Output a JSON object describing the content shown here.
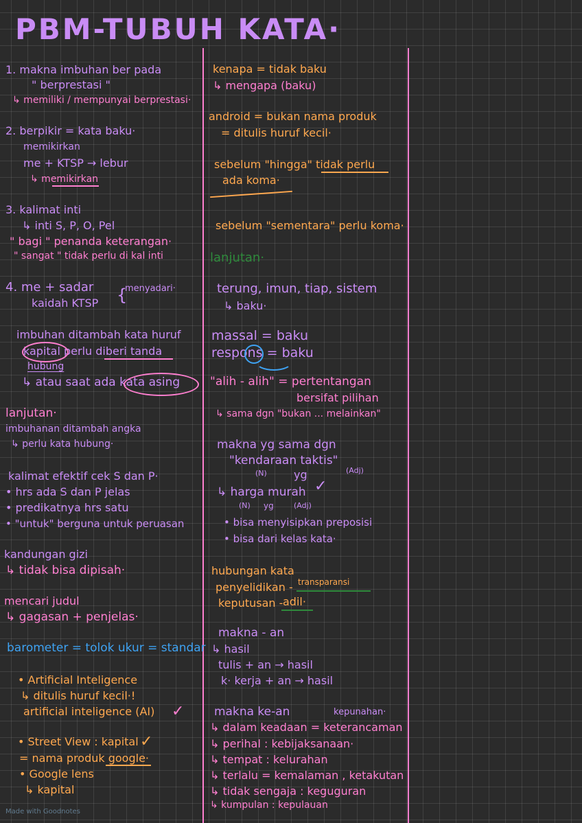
{
  "title": "PBM-TUBUH KATA·",
  "colors": {
    "background": "#2b2b2b",
    "purple": "#c98cf5",
    "pink": "#ff7fd0",
    "orange": "#ffa84f",
    "blue": "#3ea2f2",
    "green": "#2f8a3c",
    "divider": "#ff7fd0"
  },
  "left": [
    "1. makna imbuhan ber pada",
    "\" berprestasi \"",
    "↳ memiliki / mempunyai berprestasi·",
    "2. berpikir = kata baku·",
    "memikirkan",
    "me + KTSP → lebur",
    "↳ memikirkan",
    "3. kalimat inti",
    "↳ inti S, P, O, Pel",
    "\" bagi \" penanda keterangan·",
    "\" sangat \" tidak perlu di kal inti",
    "4. me + sadar",
    "menyadari·",
    "kaidah KTSP",
    "imbuhan ditambah kata huruf",
    "kapital perlu diberi tanda",
    "hubung",
    "↳ atau saat ada kata asing",
    "lanjutan·",
    "imbuhanan ditambah angka",
    "↳ perlu kata hubung·",
    "kalimat efektif cek S dan P·",
    "• hrs ada S dan P jelas",
    "• predikatnya hrs satu",
    "• \"untuk\" berguna untuk peruasan",
    "kandungan gizi",
    "↳ tidak bisa dipisah·",
    "mencari judul",
    "↳ gagasan + penjelas·",
    "barometer = tolok ukur = standar",
    "• Artificial Inteligence",
    "↳ ditulis huruf kecil·!",
    "artificial inteligence (AI)",
    "• Street View : kapital",
    "= nama produk google·",
    "• Google lens",
    "↳ kapital"
  ],
  "right": [
    "kenapa = tidak baku",
    "↳ mengapa (baku)",
    "android = bukan nama produk",
    "= ditulis huruf kecil·",
    "sebelum \"hingga\" tidak perlu",
    "ada koma·",
    "sebelum \"sementara\" perlu koma·",
    "lanjutan·",
    "terung, imun, tiap, sistem",
    "↳ baku·",
    "massal = baku",
    "respons = baku",
    "\"alih - alih\" = pertentangan",
    "bersifat pilihan",
    "↳ sama dgn \"bukan ... melainkan\"",
    "makna yg sama dgn",
    "\"kendaraan taktis\"",
    "(N)",
    "yg",
    "(Adj)",
    "↳ harga murah",
    "(N)",
    "yg",
    "(Adj)",
    "• bisa menyisipkan preposisi",
    "• bisa dari kelas kata·",
    "hubungan kata",
    "penyelidikan -",
    "transparansi",
    "keputusan -",
    "adil·",
    "makna - an",
    "↳ hasil",
    "tulis + an → hasil",
    "k· kerja + an → hasil",
    "makna ke-an",
    "kepunahan·",
    "↳ dalam keadaan = keterancaman",
    "↳ perihal : kebijaksanaan·",
    "↳ tempat : kelurahan",
    "↳ terlalu = kemalaman , ketakutan",
    "↳ tidak sengaja : keguguran",
    "↳ kumpulan : kepulauan"
  ],
  "checks": [
    "✓",
    "✓",
    "✓",
    "✓"
  ],
  "brace": "{",
  "watermark": "Made with Goodnotes"
}
